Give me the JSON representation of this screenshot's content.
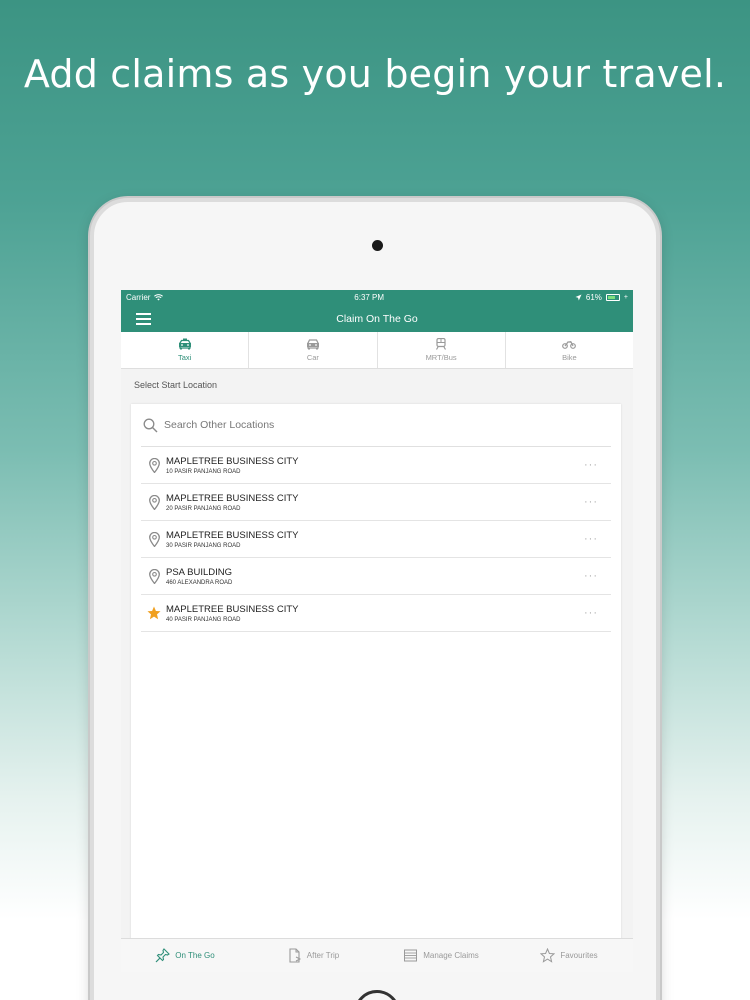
{
  "headline": "Add claims as you begin your travel.",
  "status_bar": {
    "carrier": "Carrier",
    "time": "6:37 PM",
    "battery": "61%"
  },
  "nav": {
    "title": "Claim On The Go"
  },
  "modes": [
    {
      "label": "Taxi",
      "icon": "taxi-icon",
      "active": true
    },
    {
      "label": "Car",
      "icon": "car-icon",
      "active": false
    },
    {
      "label": "MRT/Bus",
      "icon": "train-icon",
      "active": false
    },
    {
      "label": "Bike",
      "icon": "motorbike-icon",
      "active": false
    }
  ],
  "section_label": "Select Start Location",
  "search": {
    "placeholder": "Search Other Locations"
  },
  "locations": [
    {
      "name": "MAPLETREE BUSINESS CITY",
      "address": "10 PASIR PANJANG ROAD",
      "icon": "pin-icon",
      "more": "···"
    },
    {
      "name": "MAPLETREE BUSINESS CITY",
      "address": "20 PASIR PANJANG ROAD",
      "icon": "pin-icon",
      "more": "···"
    },
    {
      "name": "MAPLETREE BUSINESS CITY",
      "address": "30 PASIR PANJANG ROAD",
      "icon": "pin-icon",
      "more": "···"
    },
    {
      "name": "PSA BUILDING",
      "address": "460 ALEXANDRA ROAD",
      "icon": "pin-icon",
      "more": "···"
    },
    {
      "name": "MAPLETREE BUSINESS CITY",
      "address": "40 PASIR PANJANG ROAD",
      "icon": "star-icon",
      "more": "···"
    }
  ],
  "tabs": [
    {
      "label": "On The Go",
      "icon": "pin-push-icon",
      "active": true
    },
    {
      "label": "After Trip",
      "icon": "document-icon",
      "active": false
    },
    {
      "label": "Manage Claims",
      "icon": "list-icon",
      "active": false
    },
    {
      "label": "Favourites",
      "icon": "star-outline-icon",
      "active": false
    }
  ],
  "colors": {
    "accent": "#2f8f79",
    "favourite": "#f0a020",
    "inactive": "#9a9a9a"
  }
}
